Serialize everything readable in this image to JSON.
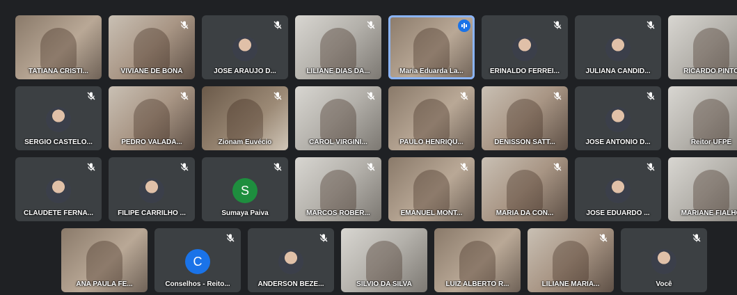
{
  "colors": {
    "background": "#1f2124",
    "tile": "#3c4043",
    "accent": "#1a73e8",
    "speaking_border": "#8ab4f8"
  },
  "participants": [
    {
      "name": "TATIANA CRISTI...",
      "type": "video",
      "muted": false
    },
    {
      "name": "VIVIANE DE BONA",
      "type": "video",
      "muted": true
    },
    {
      "name": "JOSE ARAUJO D...",
      "type": "avatar",
      "muted": true
    },
    {
      "name": "LILIANE DIAS DA...",
      "type": "video",
      "muted": true
    },
    {
      "name": "Maria Eduarda La...",
      "type": "video",
      "muted": false,
      "speaking": true
    },
    {
      "name": "ERINALDO FERREI...",
      "type": "avatar",
      "muted": true
    },
    {
      "name": "JULIANA CANDID...",
      "type": "avatar",
      "muted": true
    },
    {
      "name": "RICARDO PINTO",
      "type": "video",
      "muted": false
    },
    {
      "name": "SERGIO CASTELO...",
      "type": "avatar",
      "muted": true
    },
    {
      "name": "PEDRO VALADA...",
      "type": "video",
      "muted": true
    },
    {
      "name": "Zionam Euvécio",
      "type": "video",
      "muted": true
    },
    {
      "name": "CAROL VIRGINI...",
      "type": "video",
      "muted": true
    },
    {
      "name": "PAULO HENRIQU...",
      "type": "video",
      "muted": true
    },
    {
      "name": "DENISSON SATT...",
      "type": "video",
      "muted": true
    },
    {
      "name": "JOSE ANTONIO D...",
      "type": "avatar",
      "muted": true
    },
    {
      "name": "Reitor UFPE",
      "type": "video",
      "muted": false
    },
    {
      "name": "CLAUDETE FERNA...",
      "type": "avatar",
      "muted": true
    },
    {
      "name": "FILIPE CARRILHO ...",
      "type": "avatar",
      "muted": true
    },
    {
      "name": "Sumaya Paiva",
      "type": "letter",
      "letter": "S",
      "letter_color": "#1e8e3e",
      "muted": true
    },
    {
      "name": "MARCOS ROBER...",
      "type": "video",
      "muted": true
    },
    {
      "name": "EMANUEL MONT...",
      "type": "video",
      "muted": true
    },
    {
      "name": "MARIA DA CON...",
      "type": "video",
      "muted": true
    },
    {
      "name": "JOSE EDUARDO ...",
      "type": "avatar",
      "muted": true
    },
    {
      "name": "MARIANE FIALHO",
      "type": "video",
      "muted": false
    },
    {
      "name": "ANA PAULA FE...",
      "type": "video",
      "muted": false
    },
    {
      "name": "Conselhos - Reito...",
      "type": "letter",
      "letter": "C",
      "letter_color": "#1a73e8",
      "muted": true
    },
    {
      "name": "ANDERSON BEZE...",
      "type": "avatar",
      "muted": true
    },
    {
      "name": "SILVIO DA SILVA",
      "type": "video",
      "muted": false
    },
    {
      "name": "LUIZ ALBERTO R...",
      "type": "video",
      "muted": false
    },
    {
      "name": "LILIANE MARIA...",
      "type": "video",
      "muted": true
    },
    {
      "name": "Você",
      "type": "avatar",
      "muted": true
    }
  ]
}
